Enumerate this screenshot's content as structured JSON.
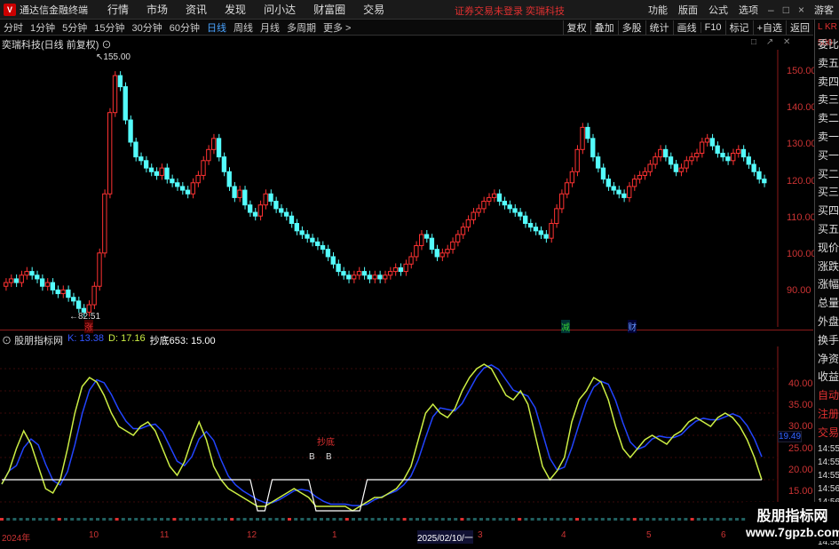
{
  "app": {
    "title": "通达信金融终端",
    "logo": "V"
  },
  "menu": {
    "items": [
      "行情",
      "市场",
      "资讯",
      "发现",
      "问小达",
      "财富圈",
      "交易"
    ],
    "status": "证券交易未登录  奕瑞科技",
    "right": [
      "功能",
      "版面",
      "公式",
      "选项"
    ],
    "guest": "游客"
  },
  "toolbar": {
    "periods": [
      "分时",
      "1分钟",
      "5分钟",
      "15分钟",
      "30分钟",
      "60分钟",
      "日线",
      "周线",
      "月线",
      "多周期",
      "更多 >"
    ],
    "active_index": 6,
    "right": [
      "复权",
      "叠加",
      "多股",
      "统计",
      "画线",
      "F10",
      "标记",
      "+自选",
      "返回"
    ]
  },
  "chart": {
    "title": "奕瑞科技(日线 前复权)",
    "high_label": "155.00",
    "low_label": "82.51",
    "price_axis": [
      "150.00",
      "140.00",
      "130.00",
      "120.00",
      "110.00",
      "100.00",
      "90.00"
    ],
    "markers": [
      "涨",
      "减",
      "财"
    ]
  },
  "indicator": {
    "name": "股朋指标网",
    "k_label": "K: 13.38",
    "d_label": "D: 17.16",
    "c_label": "抄底653: 15.00",
    "axis": [
      "40.00",
      "35.00",
      "30.00",
      "25.00",
      "20.00",
      "15.00",
      "10.00"
    ],
    "current": "19.49",
    "signal_text": "抄底",
    "b_marks": [
      "B",
      "B"
    ]
  },
  "dates": [
    "2024年",
    "10",
    "11",
    "12",
    "1",
    "2025/02/10/一",
    "3",
    "4",
    "5",
    "6"
  ],
  "right_panel": {
    "head": "L KR 500",
    "items": [
      "委比",
      "卖五",
      "卖四",
      "卖三",
      "卖二",
      "卖一",
      "买一",
      "买二",
      "买三",
      "买四",
      "买五",
      "现价",
      "涨跌",
      "涨幅",
      "总量",
      "外盘",
      "换手",
      "净资",
      "收益",
      "自动",
      "注册",
      "交易",
      "14:55",
      "14:55",
      "14:55",
      "14:56",
      "14:56",
      "14:56",
      "14:56",
      "14:56"
    ]
  },
  "watermark": {
    "cn": "股朋指标网",
    "url": "www.7gpzb.com"
  },
  "colors": {
    "up": "#ff3232",
    "down": "#54fcfc",
    "k_line": "#ccee44",
    "d_line": "#2244ff",
    "signal": "#ffffff"
  },
  "chart_data": {
    "type": "candlestick",
    "high": 155.0,
    "low": 82.51,
    "ylim": [
      82,
      157
    ],
    "closes": [
      94,
      95,
      94,
      96,
      97,
      96,
      95,
      93,
      94,
      92,
      91,
      92,
      90,
      89,
      87,
      86,
      88,
      93,
      102,
      118,
      140,
      150,
      147,
      138,
      132,
      128,
      127,
      125,
      124,
      123,
      125,
      122,
      121,
      120,
      119,
      118,
      121,
      123,
      127,
      130,
      133,
      128,
      124,
      120,
      117,
      119,
      115,
      113,
      112,
      115,
      118,
      116,
      114,
      113,
      112,
      110,
      108,
      107,
      106,
      105,
      104,
      103,
      101,
      99,
      97,
      96,
      95,
      96,
      97,
      96,
      95,
      96,
      95,
      96,
      97,
      98,
      97,
      99,
      101,
      104,
      107,
      106,
      103,
      101,
      102,
      103,
      105,
      107,
      109,
      111,
      113,
      114,
      116,
      117,
      118,
      116,
      115,
      114,
      113,
      112,
      110,
      109,
      108,
      107,
      106,
      110,
      114,
      118,
      121,
      124,
      130,
      136,
      133,
      128,
      125,
      122,
      120,
      119,
      118,
      117,
      120,
      122,
      123,
      124,
      126,
      128,
      130,
      128,
      126,
      124,
      125,
      127,
      128,
      129,
      132,
      133,
      131,
      129,
      128,
      127,
      129,
      130,
      128,
      126,
      124,
      122,
      121
    ],
    "k": [
      14,
      17,
      22,
      26,
      23,
      18,
      13,
      12,
      15,
      22,
      30,
      36,
      38,
      37,
      34,
      30,
      27,
      26,
      25,
      27,
      28,
      26,
      22,
      18,
      16,
      19,
      24,
      28,
      24,
      18,
      15,
      13,
      12,
      11,
      10,
      9,
      9,
      10,
      11,
      12,
      13,
      12,
      11,
      9,
      9,
      9,
      9,
      9,
      8,
      9,
      10,
      11,
      11,
      12,
      13,
      15,
      18,
      24,
      30,
      32,
      30,
      29,
      31,
      35,
      38,
      40,
      41,
      40,
      37,
      34,
      33,
      35,
      32,
      25,
      18,
      15,
      17,
      20,
      28,
      33,
      35,
      38,
      37,
      33,
      27,
      22,
      20,
      22,
      24,
      25,
      24,
      23,
      25,
      26,
      28,
      29,
      28,
      27,
      29,
      30,
      29,
      27,
      24,
      20,
      15
    ]
  }
}
